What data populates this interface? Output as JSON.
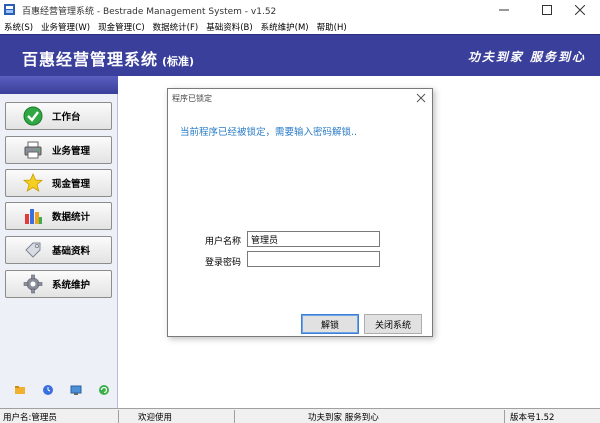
{
  "window": {
    "title": "百惠经营管理系统 - Bestrade Management System - v1.52"
  },
  "menu": [
    "系统(S)",
    "业务管理(W)",
    "现金管理(C)",
    "数据统计(F)",
    "基础资料(B)",
    "系统维护(M)",
    "帮助(H)"
  ],
  "banner": {
    "title": "百惠经营管理系统",
    "edition": "(标准)",
    "slogan": "功夫到家 服务到心"
  },
  "nav": [
    {
      "label": "工作台",
      "icon": "check-circle-icon"
    },
    {
      "label": "业务管理",
      "icon": "printer-icon"
    },
    {
      "label": "现金管理",
      "icon": "star-icon"
    },
    {
      "label": "数据统计",
      "icon": "bar-chart-icon"
    },
    {
      "label": "基础资料",
      "icon": "tag-icon"
    },
    {
      "label": "系统维护",
      "icon": "gear-icon"
    }
  ],
  "dialog": {
    "title": "程序已锁定",
    "message": "当前程序已经被锁定，需要输入密码解锁..",
    "username_label": "用户名称",
    "username_value": "管理员",
    "password_label": "登录密码",
    "password_value": "",
    "unlock_label": "解锁",
    "close_label": "关闭系统"
  },
  "status": {
    "user": "用户名:管理员",
    "welcome": "欢迎使用",
    "slogan": "功夫到家 服务到心",
    "version": "版本号1.52"
  },
  "colors": {
    "banner": "#3a3f9b",
    "message": "#2a7cc7"
  }
}
